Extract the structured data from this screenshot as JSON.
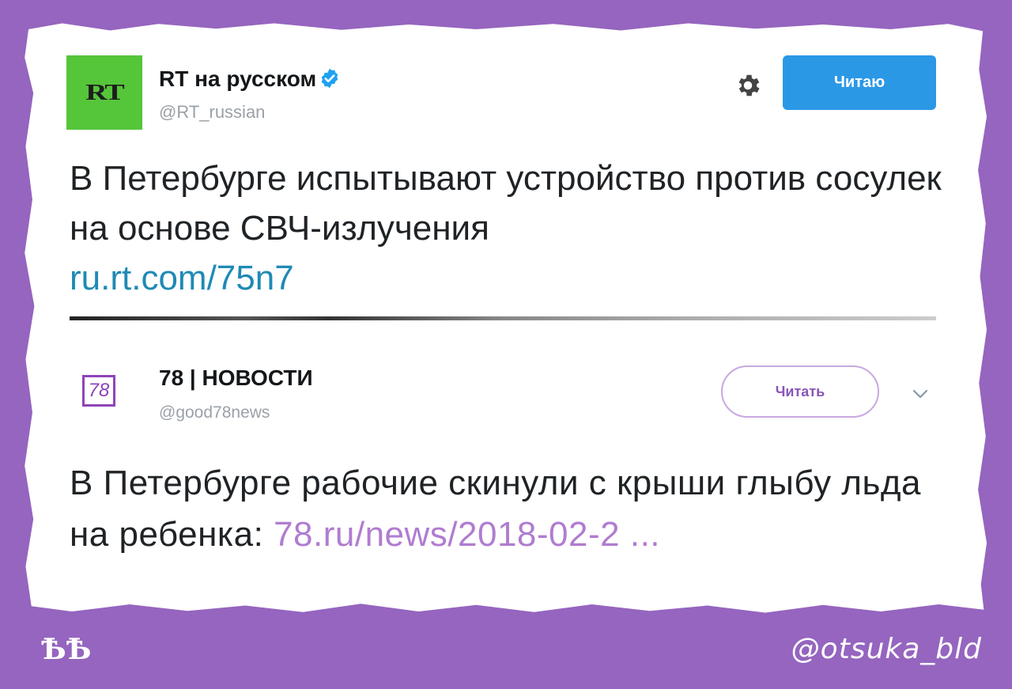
{
  "tweet1": {
    "avatar_text": "RT",
    "display_name": "RT на русском",
    "handle": "@RT_russian",
    "follow_label": "Читаю",
    "text": "В Петербурге испытывают устройство против сосулек на основе СВЧ-излучения",
    "link": "ru.rt.com/75n7",
    "icons": [
      "verified-badge",
      "gear"
    ]
  },
  "tweet2": {
    "avatar_text": "78",
    "display_name": "78 | НОВОСТИ",
    "handle": "@good78news",
    "follow_label": "Читать",
    "text": "В Петербурге рабочие скинули с крыши глыбу льда на ребенка: ",
    "link": "78.ru/news/2018-02-2  ...",
    "icons": [
      "chevron-down"
    ]
  },
  "overlay": {
    "corner_mark": "ѢѢ",
    "watermark": "@otsuka_bld"
  },
  "colors": {
    "background": "#9565bf",
    "rt_green": "#55c53a",
    "follow_blue": "#2b98e6",
    "link_blue": "#1f8ab4",
    "purple_accent": "#8e44b8",
    "purple_link": "#b07cd0"
  }
}
